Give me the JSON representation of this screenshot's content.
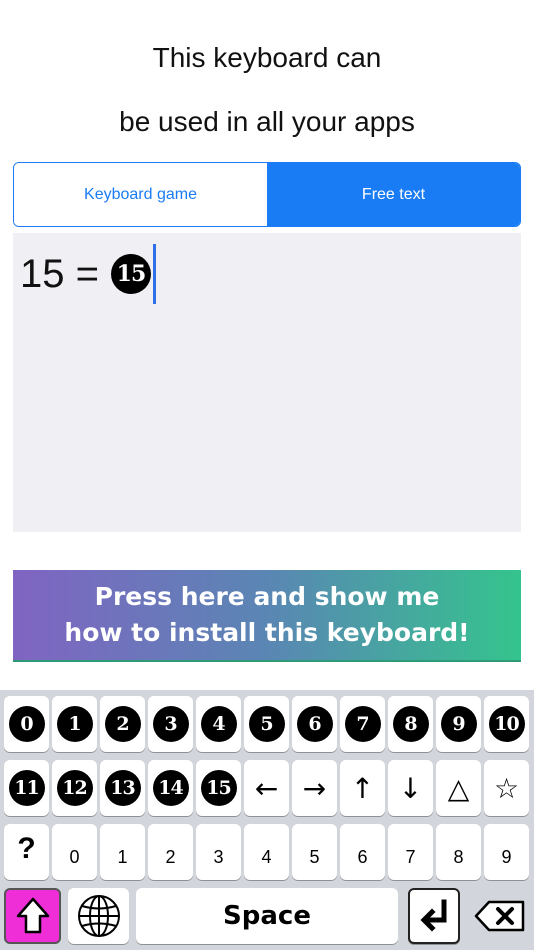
{
  "header": {
    "line1": "This keyboard can",
    "line2": "be used in all your apps"
  },
  "tabs": [
    {
      "label": "Keyboard game",
      "selected": false
    },
    {
      "label": "Free text",
      "selected": true
    }
  ],
  "editor": {
    "text": "15 =",
    "symbol": "15"
  },
  "banner": {
    "line1": "Press here and show me",
    "line2": "how to install this keyboard!"
  },
  "keyboard": {
    "row1": [
      "0",
      "1",
      "2",
      "3",
      "4",
      "5",
      "6",
      "7",
      "8",
      "9",
      "10"
    ],
    "row2": [
      "11",
      "12",
      "13",
      "14",
      "15",
      "←",
      "→",
      "↑",
      "↓",
      "△",
      "☆"
    ],
    "row3": [
      "?",
      "0",
      "1",
      "2",
      "3",
      "4",
      "5",
      "6",
      "7",
      "8",
      "9"
    ],
    "space_label": "Space"
  },
  "colors": {
    "accent": "#1a7cf5",
    "shift": "#ef2ed8"
  }
}
